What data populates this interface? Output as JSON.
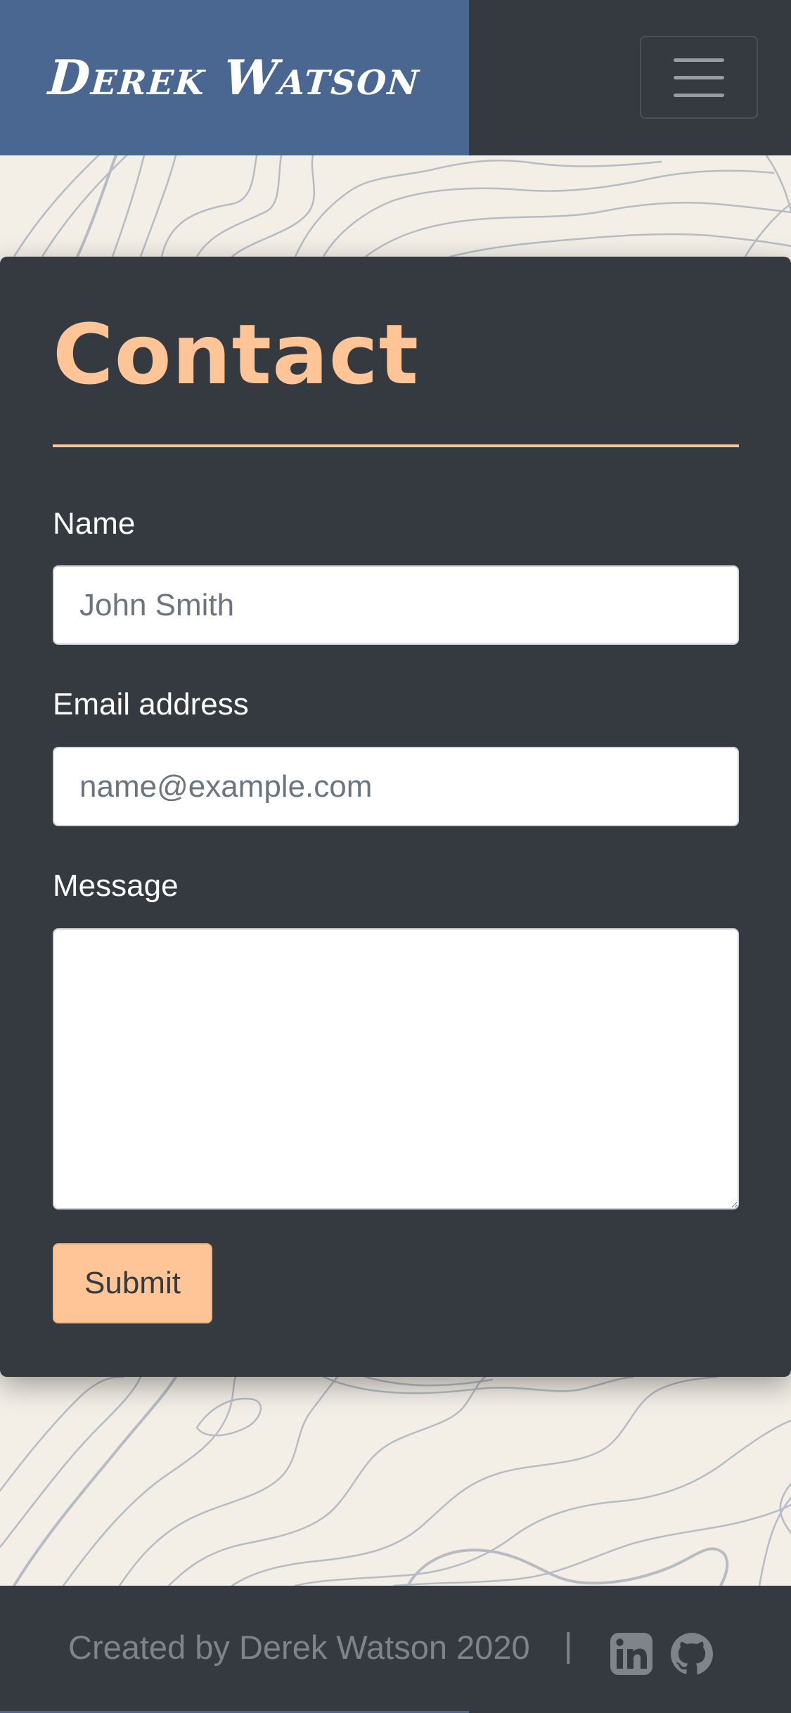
{
  "navbar": {
    "brand": "Derek Watson",
    "menu_icon": "hamburger-menu-icon",
    "colors": {
      "brand_bg": "#4a6791",
      "nav_bg": "#343a40"
    }
  },
  "contact": {
    "title": "Contact",
    "accent_color": "#ffc596",
    "name_label": "Name",
    "name_placeholder": "John Smith",
    "email_label": "Email address",
    "email_placeholder": "name@example.com",
    "message_label": "Message",
    "submit_label": "Submit"
  },
  "footer": {
    "credit": "Created by Derek Watson 2020",
    "separator": "|",
    "icons": [
      "linkedin-icon",
      "github-icon"
    ]
  }
}
